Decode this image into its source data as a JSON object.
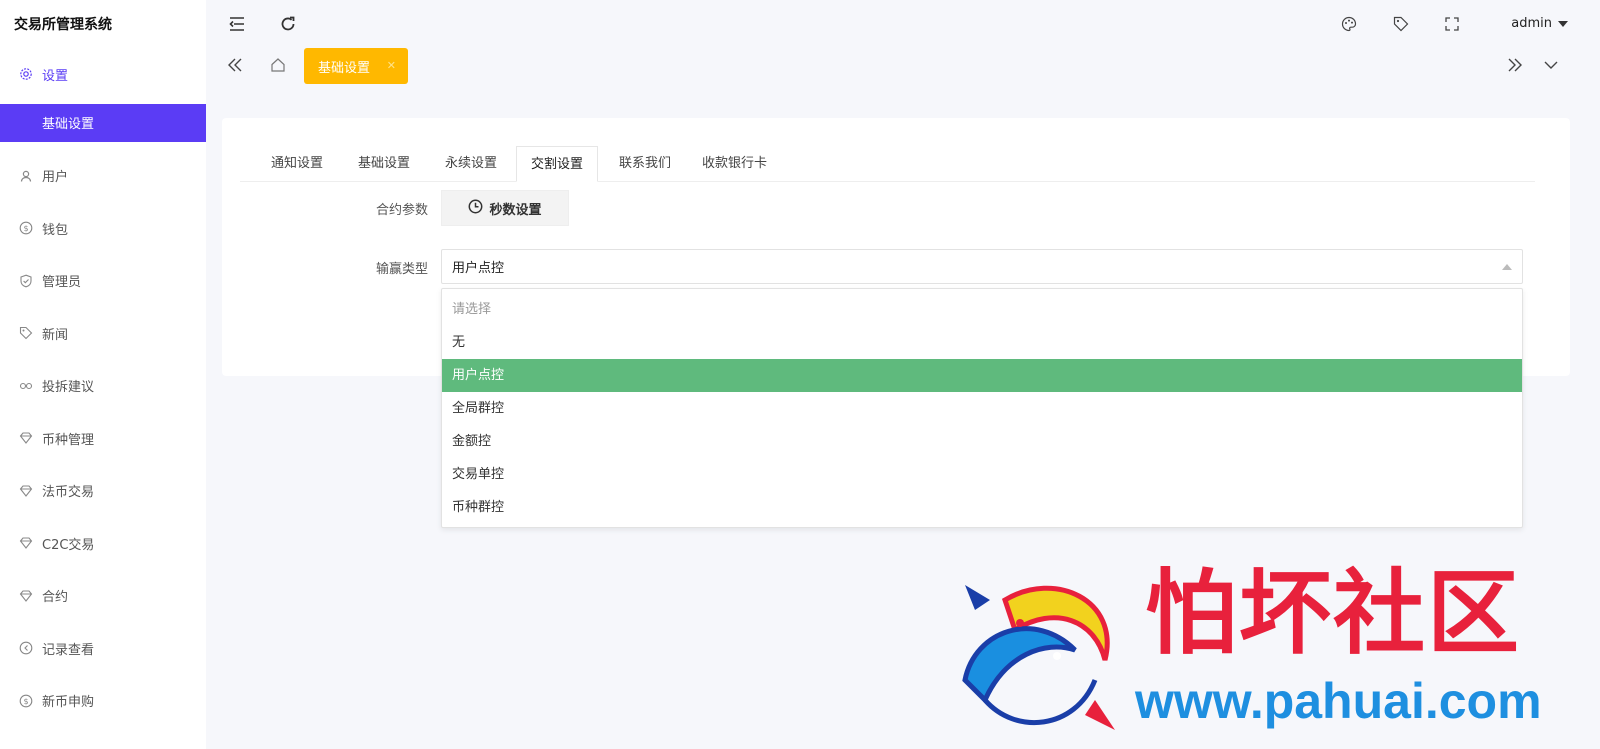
{
  "app": {
    "title": "交易所管理系统"
  },
  "sidebar": {
    "items": [
      {
        "label": "设置",
        "icon": "gear-icon"
      },
      {
        "label": "基础设置",
        "icon": ""
      },
      {
        "label": "用户",
        "icon": "user-icon"
      },
      {
        "label": "钱包",
        "icon": "dollar-icon"
      },
      {
        "label": "管理员",
        "icon": "shield-icon"
      },
      {
        "label": "新闻",
        "icon": "tag-icon"
      },
      {
        "label": "投拆建议",
        "icon": "link-icon"
      },
      {
        "label": "币种管理",
        "icon": "diamond-icon"
      },
      {
        "label": "法币交易",
        "icon": "diamond-icon"
      },
      {
        "label": "C2C交易",
        "icon": "diamond-icon"
      },
      {
        "label": "合约",
        "icon": "diamond-icon"
      },
      {
        "label": "记录查看",
        "icon": "circle-arrow-icon"
      },
      {
        "label": "新币申购",
        "icon": "dollar-icon"
      }
    ]
  },
  "topbar": {
    "user": "admin"
  },
  "tabsbar": {
    "active_tab": "基础设置"
  },
  "card": {
    "tabs": [
      "通知设置",
      "基础设置",
      "永续设置",
      "交割设置",
      "联系我们",
      "收款银行卡"
    ],
    "active_tab_index": 3,
    "contract_label": "合约参数",
    "seconds_button": "秒数设置",
    "winloss_label": "输赢类型",
    "select_value": "用户点控",
    "options": [
      "请选择",
      "无",
      "用户点控",
      "全局群控",
      "金额控",
      "交易单控",
      "币种群控"
    ],
    "selected_option": "用户点控"
  },
  "watermark": {
    "text": "怕坏社区",
    "url": "www.pahuai.com"
  }
}
